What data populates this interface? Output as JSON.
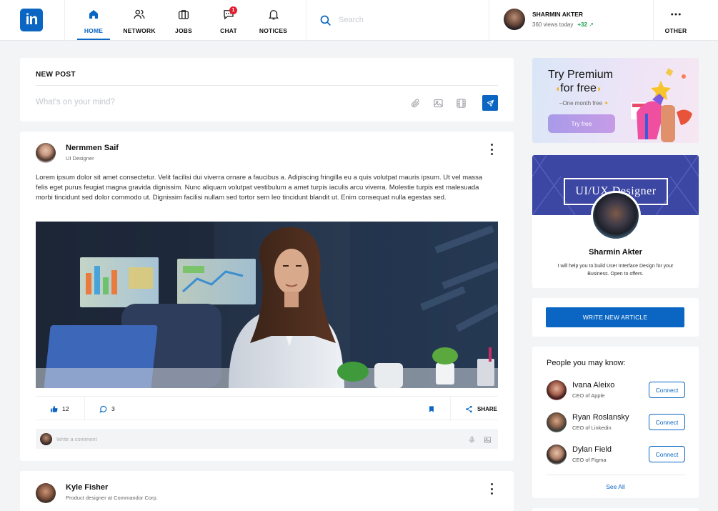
{
  "header": {
    "logo_text": "in",
    "nav": [
      {
        "label": "HOME"
      },
      {
        "label": "NETWORK"
      },
      {
        "label": "JOBS"
      },
      {
        "label": "CHAT",
        "badge": "1"
      },
      {
        "label": "NOTICES"
      }
    ],
    "other_label": "OTHER",
    "search": {
      "placeholder": "Search"
    },
    "user": {
      "name": "SHARMIN AKTER",
      "views": "360 views today",
      "delta": "+32"
    }
  },
  "new_post": {
    "title": "NEW POST",
    "placeholder": "What's on your mind?"
  },
  "posts": [
    {
      "author": "Nermmen Saif",
      "role": "UI Designer",
      "body": "Lorem ipsum dolor sit amet consectetur. Velit facilisi dui viverra ornare a faucibus a. Adipiscing fringilla eu a quis volutpat mauris ipsum. Ut vel massa felis eget purus feugiat magna gravida dignissim. Nunc aliquam volutpat vestibulum a amet turpis iaculis arcu viverra. Molestie turpis est malesuada morbi tincidunt sed dolor commodo ut. Dignissim facilisi nullam sed tortor sem leo tincidunt blandit ut. Enim consequat nulla egestas sed.",
      "likes": "12",
      "comments": "3",
      "share_label": "SHARE",
      "comment_placeholder": "Write a comment"
    },
    {
      "author": "Kyle Fisher",
      "role": "Product designer at Commandor Corp."
    }
  ],
  "premium": {
    "line1": "Try Premium",
    "line2": "for free",
    "sub": "One month free",
    "button": "Try free"
  },
  "profile": {
    "banner_text": "UI/UX Designer",
    "name": "Sharmin Akter",
    "description": "I will help you to build User Interface Design for your Business. Open to offers."
  },
  "write_article": "WRITE NEW ARTICLE",
  "pymk": {
    "title": "People you may know:",
    "people": [
      {
        "name": "Ivana Aleixo",
        "role": "CEO of Apple",
        "button": "Connect"
      },
      {
        "name": "Ryan Roslansky",
        "role": "CEO of Linkedin",
        "button": "Connect"
      },
      {
        "name": "Dylan Field",
        "role": "CEO of Figma",
        "button": "Connect"
      }
    ],
    "see_all": "See All"
  },
  "colors": {
    "brand": "#0a66c2",
    "badge": "#e11d2e",
    "banner": "#3c46a3"
  }
}
